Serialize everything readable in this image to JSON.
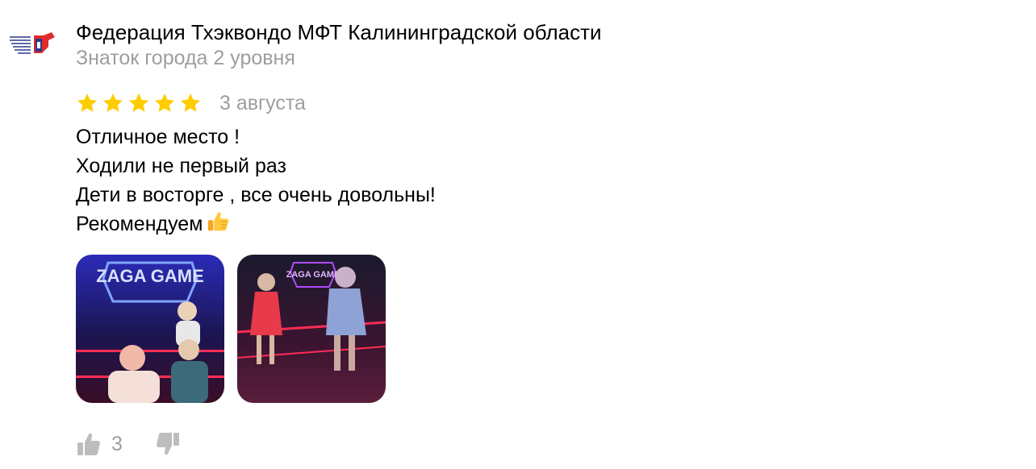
{
  "author": {
    "name": "Федерация Тхэквондо МФТ Калининградской области",
    "level": "Знаток города 2 уровня",
    "avatar_icon": "federation-logo-icon"
  },
  "review": {
    "rating": 5,
    "rating_max": 5,
    "date": "3 августа",
    "text_lines": [
      "Отличное место !",
      "Ходили не первый раз",
      "Дети в восторге , все очень довольны!",
      "Рекомендуем"
    ],
    "emoji_icon": "thumbs-up-emoji-icon"
  },
  "photos": [
    {
      "sign_text": "ZAGA GAME",
      "icon": "photo-thumbnail-icon"
    },
    {
      "sign_text": "ZAGA GAME",
      "icon": "photo-thumbnail-icon"
    }
  ],
  "reactions": {
    "likes": "3",
    "like_icon": "thumbs-up-icon",
    "dislike_icon": "thumbs-down-icon"
  },
  "colors": {
    "star": "#fc0",
    "muted_text": "#9e9e9e",
    "icon_gray": "#bdbdbd",
    "neon_blue": "#3d5bff",
    "neon_red": "#ff2d55"
  }
}
